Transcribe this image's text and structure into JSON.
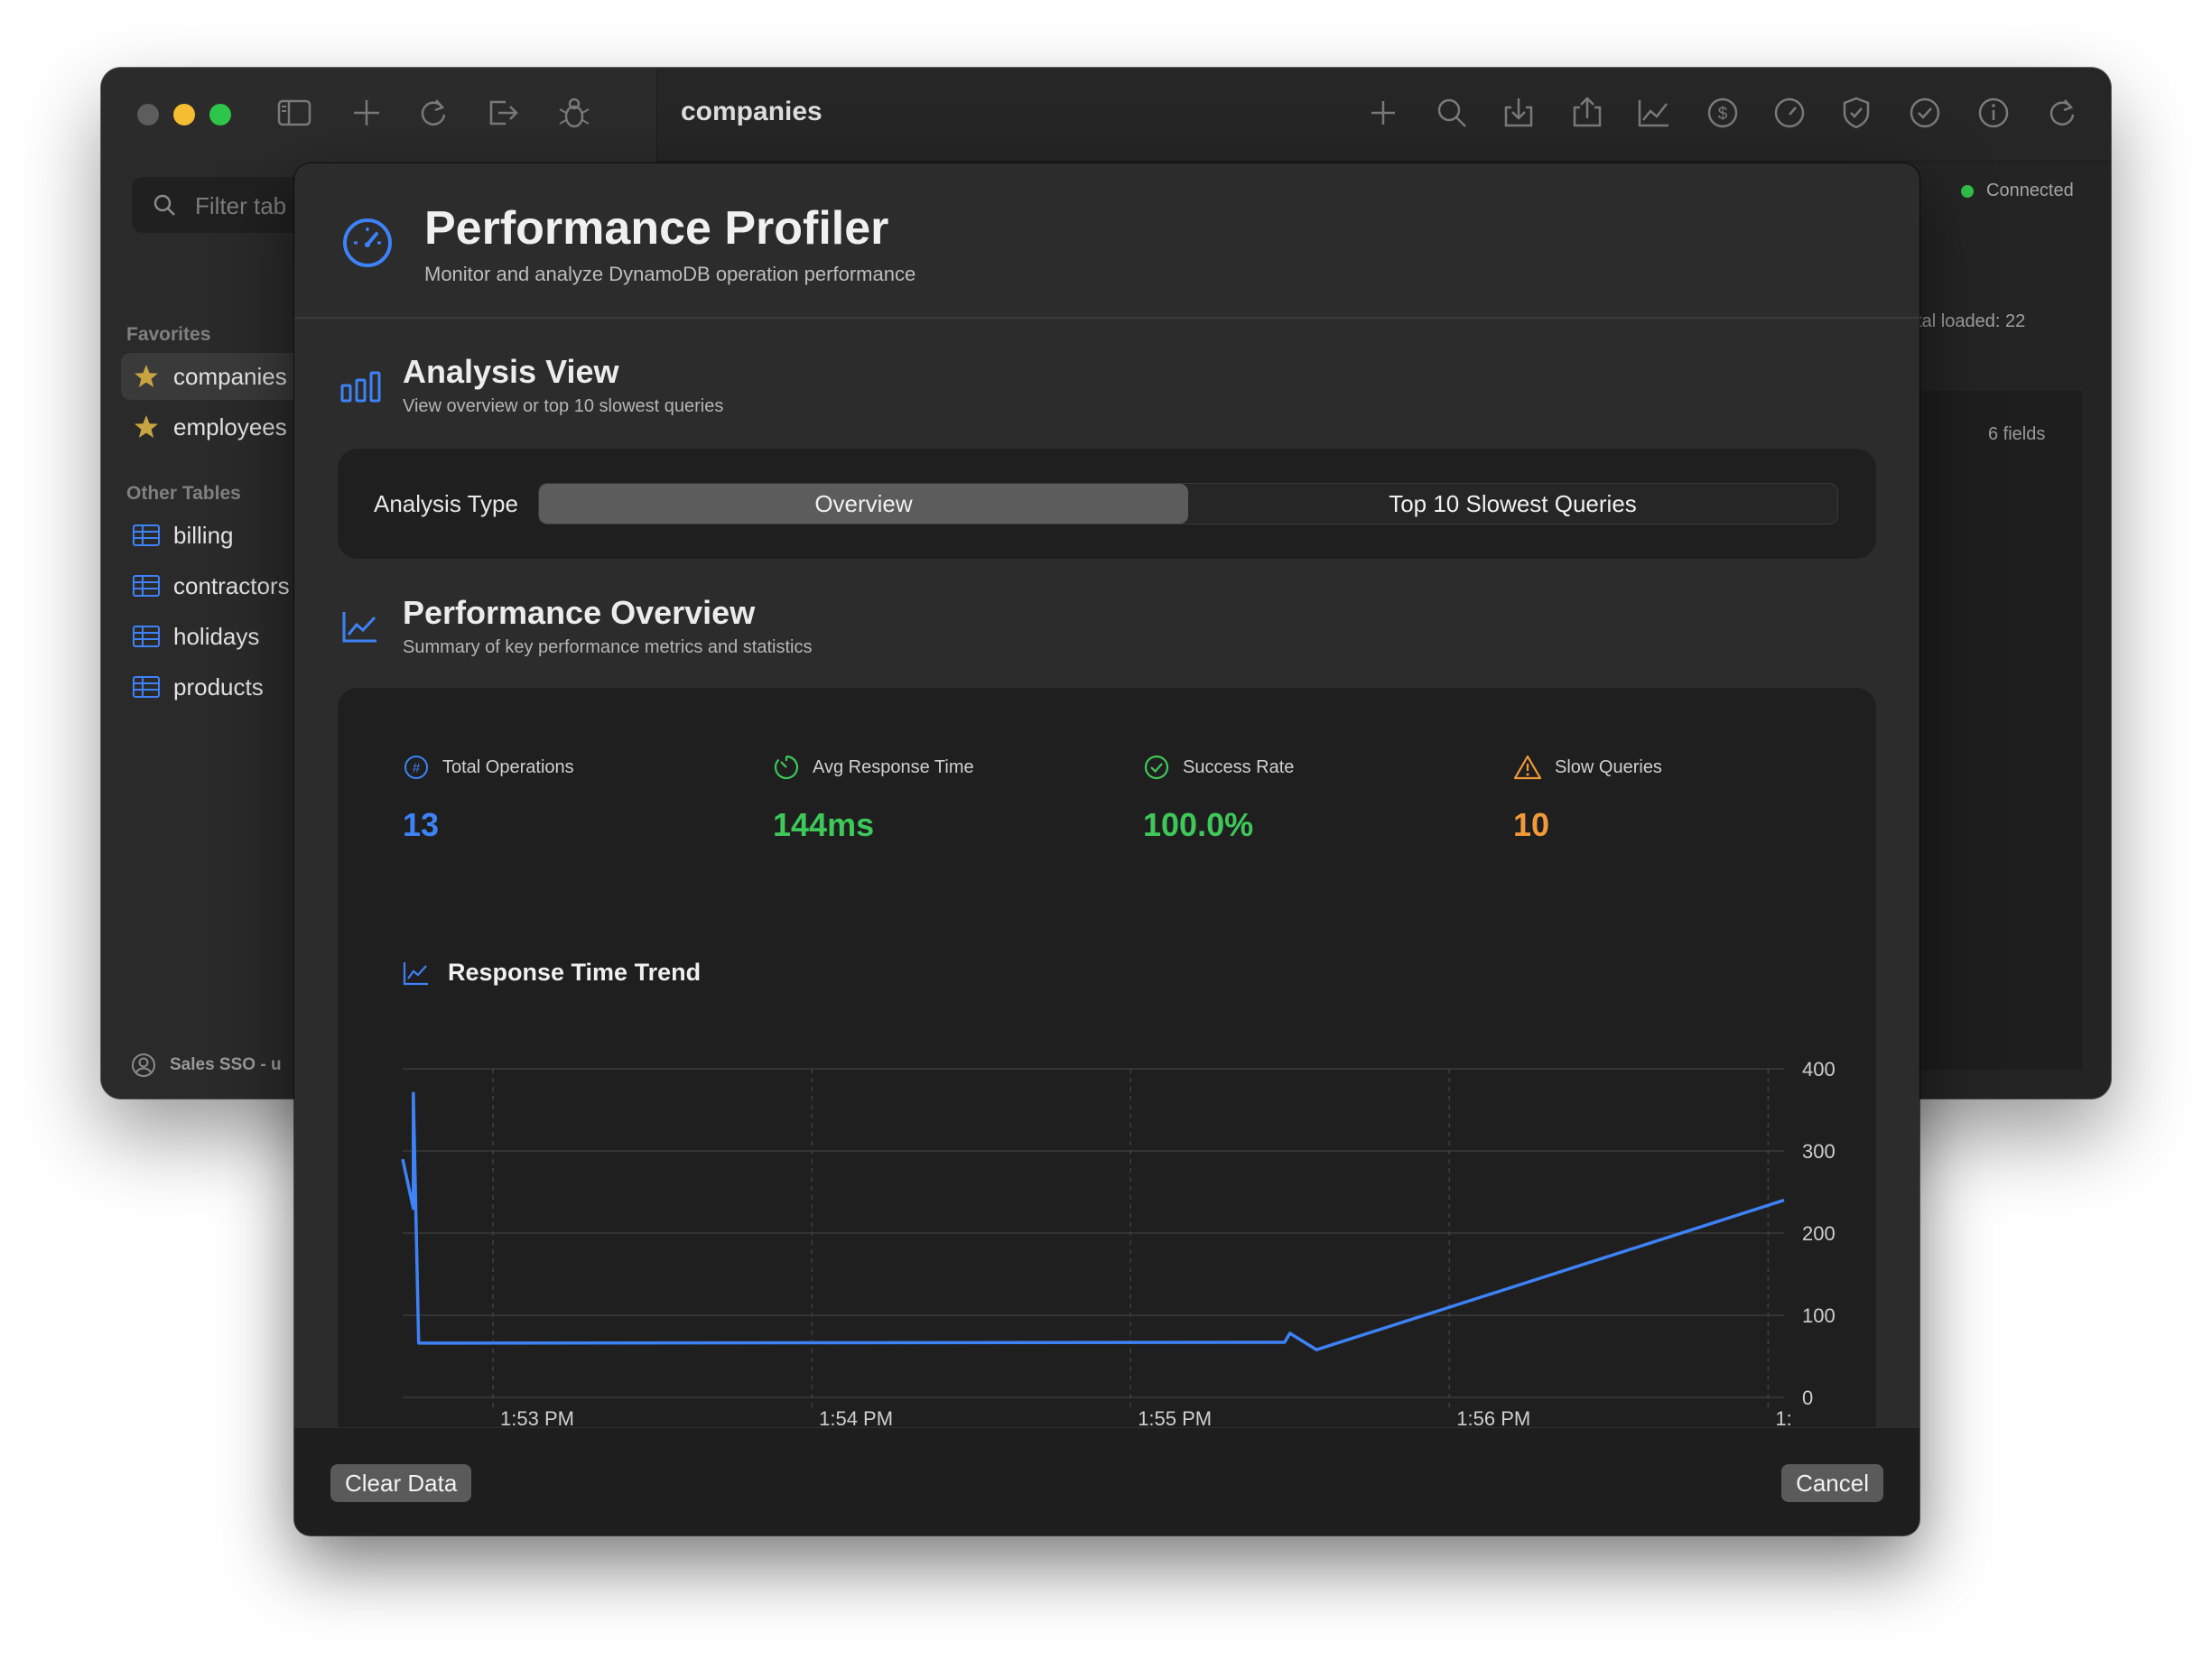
{
  "window": {
    "title": "companies",
    "connection_status": "Connected",
    "total_loaded": "otal loaded: 22",
    "fields_count": "6 fields",
    "account": "Sales SSO - u"
  },
  "toolbar": {
    "left_icons": [
      "sidebar-toggle-icon",
      "plus-icon",
      "refresh-icon",
      "sign-out-icon",
      "ant-icon"
    ],
    "right_icons": [
      "plus-icon",
      "search-icon",
      "download-icon",
      "share-icon",
      "chart-icon",
      "dollar-icon",
      "gauge-icon",
      "shield-icon",
      "checkmark-icon",
      "info-icon",
      "refresh-icon"
    ]
  },
  "sidebar": {
    "filter_placeholder": "Filter tab",
    "favorites_heading": "Favorites",
    "favorites": [
      "companies",
      "employees"
    ],
    "other_heading": "Other Tables",
    "tables": [
      "billing",
      "contractors",
      "holidays",
      "products"
    ]
  },
  "modal": {
    "title": "Performance Profiler",
    "subtitle": "Monitor and analyze DynamoDB operation performance",
    "analysis_view": {
      "title": "Analysis View",
      "subtitle": "View overview or top 10 slowest queries",
      "type_label": "Analysis Type",
      "options": [
        "Overview",
        "Top 10 Slowest Queries"
      ],
      "selected": "Overview"
    },
    "overview": {
      "title": "Performance Overview",
      "subtitle": "Summary of key performance metrics and statistics",
      "stats": [
        {
          "label": "Total Operations",
          "value": "13",
          "color": "#3d82f6",
          "icon": "number-circle-icon"
        },
        {
          "label": "Avg Response Time",
          "value": "144ms",
          "color": "#3ec85a",
          "icon": "timer-icon"
        },
        {
          "label": "Success Rate",
          "value": "100.0%",
          "color": "#3ec85a",
          "icon": "checkmark-circle-icon"
        },
        {
          "label": "Slow Queries",
          "value": "10",
          "color": "#f2993a",
          "icon": "warning-triangle-icon"
        }
      ],
      "trend_title": "Response Time Trend"
    },
    "buttons": {
      "clear": "Clear Data",
      "cancel": "Cancel"
    }
  },
  "chart_data": {
    "type": "line",
    "title": "Response Time Trend",
    "x_ticks": [
      "1:53 PM",
      "1:54 PM",
      "1:55 PM",
      "1:56 PM",
      "1:"
    ],
    "y_ticks": [
      0,
      100,
      200,
      300,
      400
    ],
    "ylim": [
      0,
      400
    ],
    "xlim": [
      "1:52:43 PM",
      "1:57:03 PM"
    ],
    "grid": true,
    "series": [
      {
        "color": "#3d82f6",
        "points": [
          {
            "x": "1:52:43 PM",
            "y": 290
          },
          {
            "x": "1:52:45 PM",
            "y": 230
          },
          {
            "x": "1:52:45 PM",
            "y": 370
          },
          {
            "x": "1:52:46 PM",
            "y": 66
          },
          {
            "x": "1:55:29 PM",
            "y": 67
          },
          {
            "x": "1:55:30 PM",
            "y": 78
          },
          {
            "x": "1:55:34 PM",
            "y": 62
          },
          {
            "x": "1:55:35 PM",
            "y": 58
          },
          {
            "x": "1:57:03 PM",
            "y": 240
          }
        ]
      }
    ]
  }
}
